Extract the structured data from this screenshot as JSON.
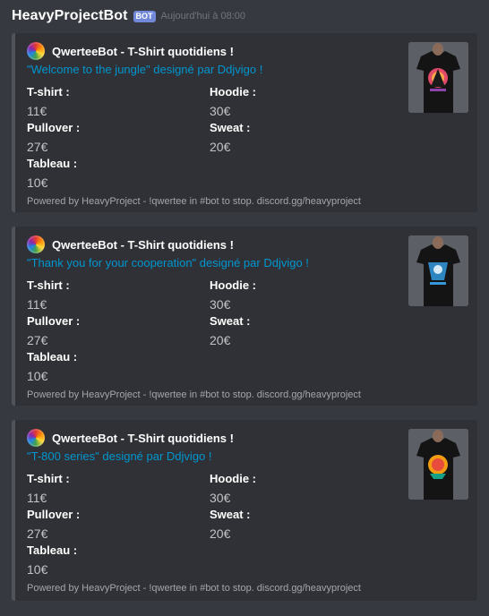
{
  "message": {
    "author": "HeavyProjectBot",
    "badge": "BOT",
    "timestamp": "Aujourd'hui à 08:00"
  },
  "embeds": [
    {
      "author_name": "QwerteeBot - T-Shirt quotidiens !",
      "title": "\"Welcome to the jungle\" designé par Ddjvigo !",
      "fields": [
        {
          "name": "T-shirt :",
          "value": "11€"
        },
        {
          "name": "Hoodie :",
          "value": "30€"
        },
        {
          "name": "Pullover :",
          "value": "27€"
        },
        {
          "name": "Sweat :",
          "value": "20€"
        },
        {
          "name": "Tableau :",
          "value": "10€"
        }
      ],
      "footer": "Powered by HeavyProject - !qwertee in #bot to stop. discord.gg/heavyproject"
    },
    {
      "author_name": "QwerteeBot - T-Shirt quotidiens !",
      "title": "\"Thank you for your cooperation\" designé par Ddjvigo !",
      "fields": [
        {
          "name": "T-shirt :",
          "value": "11€"
        },
        {
          "name": "Hoodie :",
          "value": "30€"
        },
        {
          "name": "Pullover :",
          "value": "27€"
        },
        {
          "name": "Sweat :",
          "value": "20€"
        },
        {
          "name": "Tableau :",
          "value": "10€"
        }
      ],
      "footer": "Powered by HeavyProject - !qwertee in #bot to stop. discord.gg/heavyproject"
    },
    {
      "author_name": "QwerteeBot - T-Shirt quotidiens !",
      "title": "\"T-800 series\" designé par Ddjvigo !",
      "fields": [
        {
          "name": "T-shirt :",
          "value": "11€"
        },
        {
          "name": "Hoodie :",
          "value": "30€"
        },
        {
          "name": "Pullover :",
          "value": "27€"
        },
        {
          "name": "Sweat :",
          "value": "20€"
        },
        {
          "name": "Tableau :",
          "value": "10€"
        }
      ],
      "footer": "Powered by HeavyProject - !qwertee in #bot to stop. discord.gg/heavyproject"
    }
  ]
}
